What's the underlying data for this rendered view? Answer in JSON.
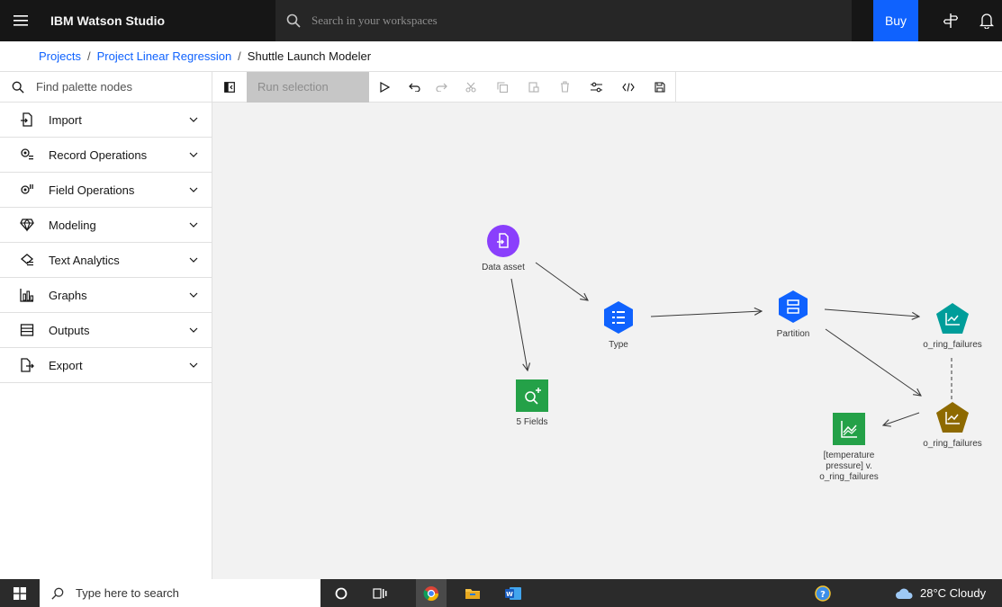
{
  "header": {
    "brand": "IBM Watson Studio",
    "search_placeholder": "Search in your workspaces",
    "buy_label": "Buy"
  },
  "breadcrumb": {
    "items": [
      "Projects",
      "Project Linear Regression"
    ],
    "current": "Shuttle Launch Modeler"
  },
  "palette": {
    "search_placeholder": "Find palette nodes",
    "categories": [
      {
        "label": "Import",
        "icon": "import-icon"
      },
      {
        "label": "Record Operations",
        "icon": "record-operations-icon"
      },
      {
        "label": "Field Operations",
        "icon": "field-operations-icon"
      },
      {
        "label": "Modeling",
        "icon": "modeling-icon"
      },
      {
        "label": "Text Analytics",
        "icon": "text-analytics-icon"
      },
      {
        "label": "Graphs",
        "icon": "graphs-icon"
      },
      {
        "label": "Outputs",
        "icon": "outputs-icon"
      },
      {
        "label": "Export",
        "icon": "export-icon"
      }
    ]
  },
  "toolbar": {
    "run_selection_label": "Run selection"
  },
  "flow": {
    "nodes": [
      {
        "id": "data-asset",
        "label": "Data asset",
        "color": "#8a3ffc",
        "shape": "circle",
        "icon": "data-asset-icon"
      },
      {
        "id": "type",
        "label": "Type",
        "color": "#0f62fe",
        "shape": "hexagon",
        "icon": "type-icon"
      },
      {
        "id": "partition",
        "label": "Partition",
        "color": "#0f62fe",
        "shape": "hexagon",
        "icon": "partition-icon"
      },
      {
        "id": "o-ring-1",
        "label": "o_ring_failures",
        "color": "#009d9a",
        "shape": "pentagon",
        "icon": "model-nugget-icon"
      },
      {
        "id": "o-ring-2",
        "label": "o_ring_failures",
        "color": "#8e6a00",
        "shape": "pentagon",
        "icon": "model-nugget-icon"
      },
      {
        "id": "fields",
        "label": "5 Fields",
        "color": "#24a148",
        "shape": "square",
        "icon": "data-audit-icon"
      },
      {
        "id": "plot",
        "label": "[temperature pressure] v. o_ring_failures",
        "color": "#24a148",
        "shape": "square",
        "icon": "plot-icon"
      }
    ]
  },
  "taskbar": {
    "search_placeholder": "Type here to search",
    "weather": "28°C Cloudy"
  }
}
